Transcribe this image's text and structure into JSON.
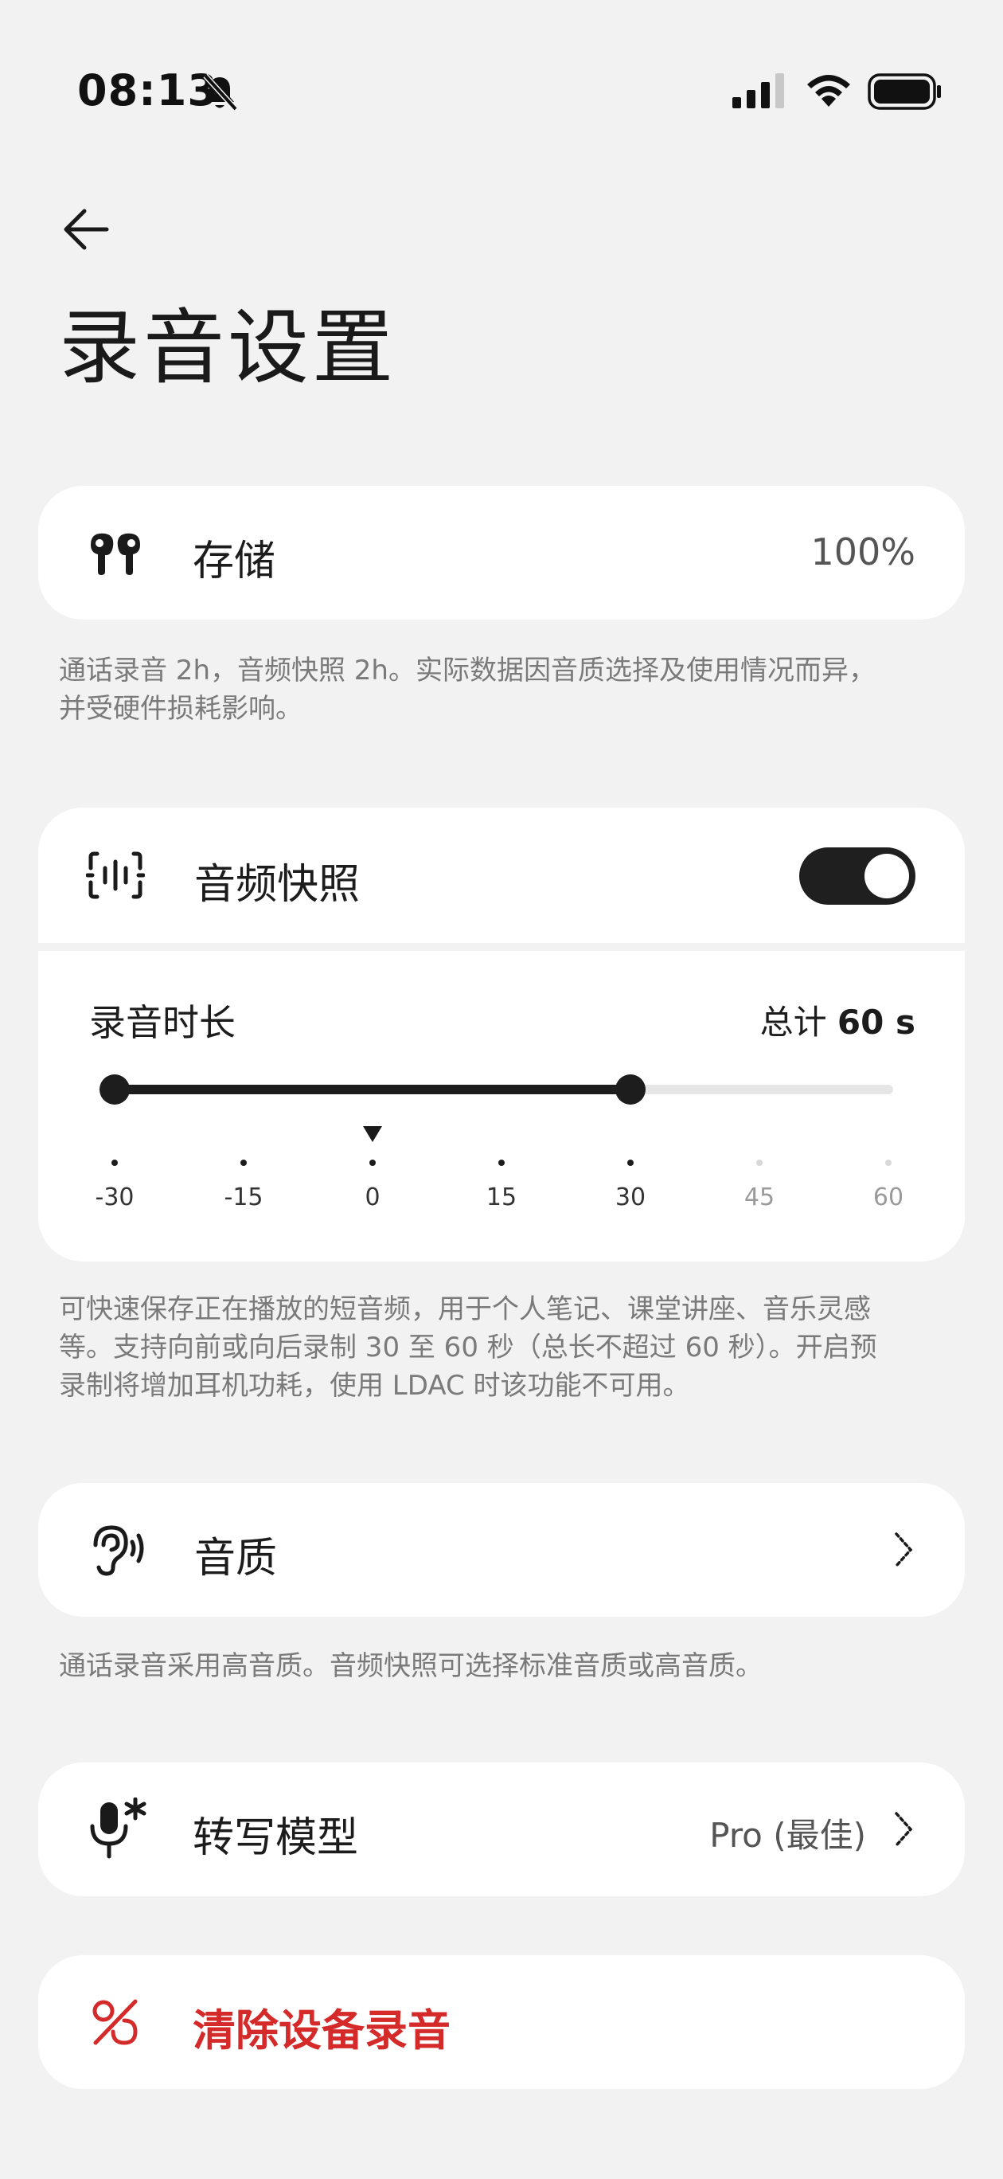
{
  "status_bar": {
    "time": "08:13"
  },
  "page": {
    "title": "录音设置"
  },
  "storage": {
    "label": "存储",
    "value": "100%",
    "note_line1": "通话录音 2h，音频快照 2h。实际数据因音质选择及使用情况而异，",
    "note_line2": "并受硬件损耗影响。"
  },
  "audio_snapshot": {
    "label": "音频快照",
    "enabled": true,
    "duration_label": "录音时长",
    "total_prefix": "总计 ",
    "total_value": "60 s",
    "range_start": -30,
    "range_end": 30,
    "marker_at": 0,
    "ticks": [
      "-30",
      "-15",
      "0",
      "15",
      "30",
      "45",
      "60"
    ],
    "note_line1": "可快速保存正在播放的短音频，用于个人笔记、课堂讲座、音乐灵感",
    "note_line2": "等。支持向前或向后录制 30 至 60 秒（总长不超过 60 秒）。开启预",
    "note_line3": "录制将增加耳机功耗，使用 LDAC 时该功能不可用。"
  },
  "quality": {
    "label": "音质",
    "note": "通话录音采用高音质。音频快照可选择标准音质或高音质。"
  },
  "model": {
    "label": "转写模型",
    "value": "Pro (最佳)"
  },
  "clear": {
    "label": "清除设备录音",
    "color": "#d42a2a"
  },
  "icons": {
    "back": "arrow-left-icon",
    "storage": "earbuds-icon",
    "snapshot": "audio-wave-icon",
    "quality": "ear-icon",
    "model": "mic-sparkle-icon",
    "clear": "delete-record-icon"
  }
}
